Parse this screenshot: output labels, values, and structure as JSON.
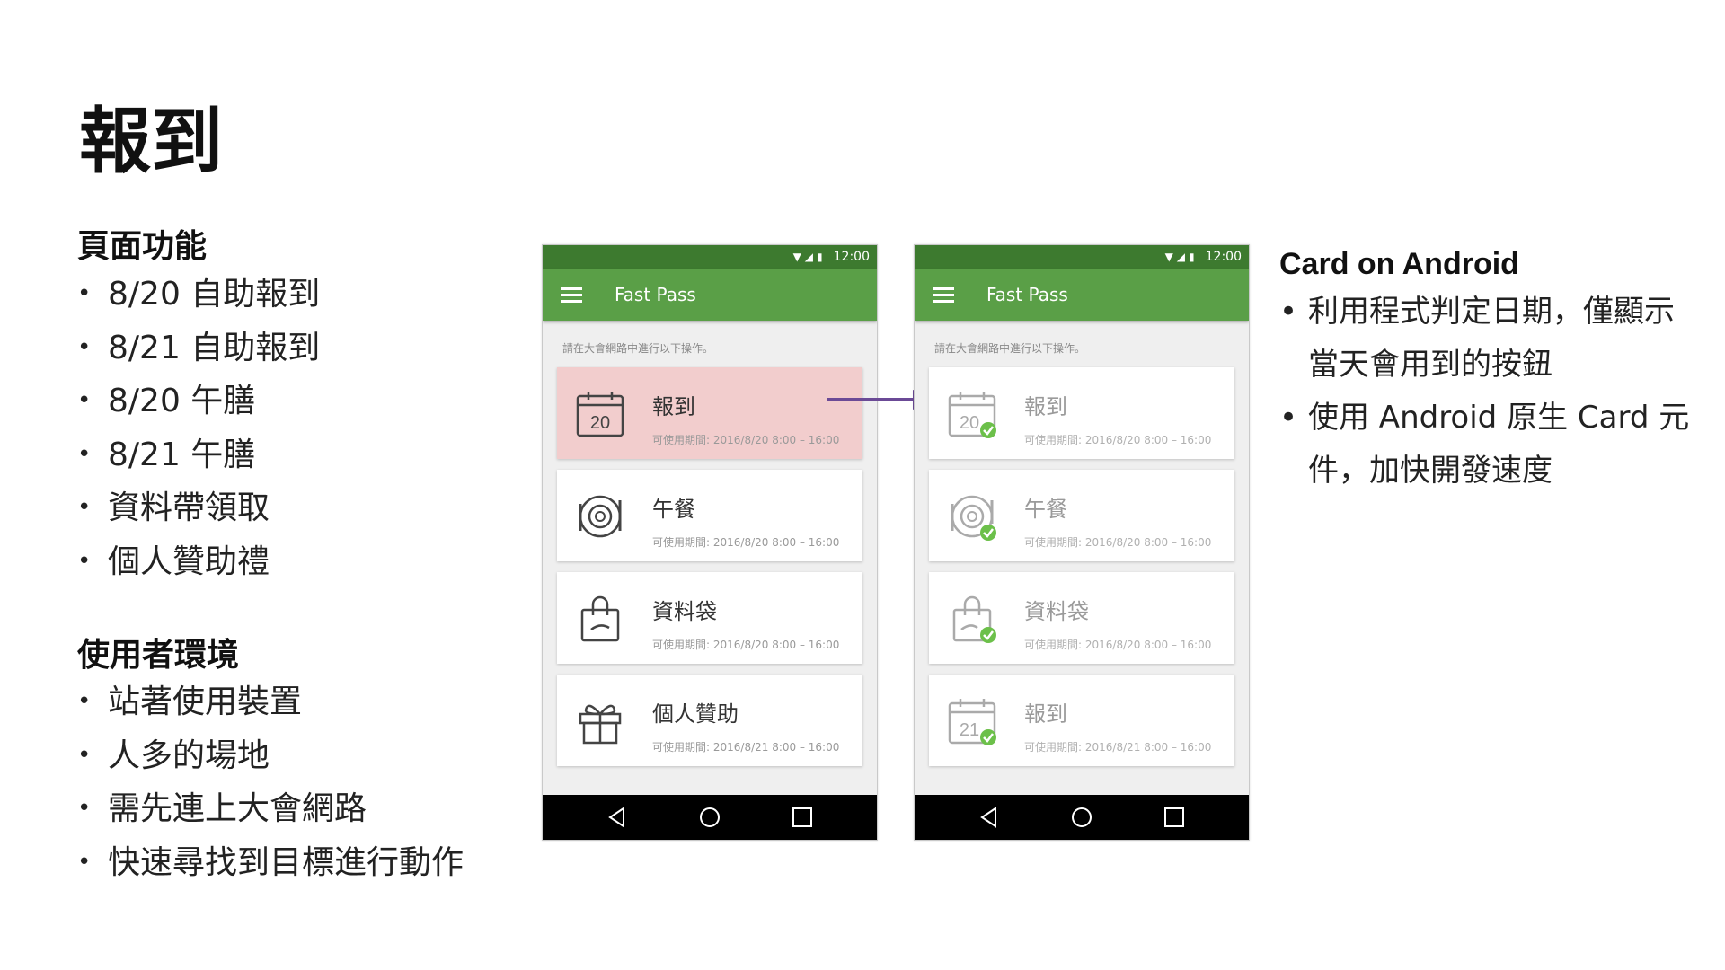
{
  "slide": {
    "title": "報到",
    "features": {
      "heading": "頁面功能",
      "items": [
        "8/20 自助報到",
        "8/21 自助報到",
        "8/20 午膳",
        "8/21 午膳",
        "資料帶領取",
        "個人贊助禮"
      ]
    },
    "environment": {
      "heading": "使用者環境",
      "items": [
        "站著使用裝置",
        "人多的場地",
        "需先連上大會網路",
        "快速尋找到目標進行動作"
      ]
    },
    "notes": {
      "heading": "Card on Android",
      "items": [
        "利用程式判定日期，僅顯示當天會用到的按鈕",
        "使用 Android 原生 Card 元件，加快開發速度"
      ]
    }
  },
  "bullet_char": "•",
  "phone_before": {
    "status_time": "12:00",
    "app_title": "Fast Pass",
    "hint": "請在大會網路中進行以下操作。",
    "cards": [
      {
        "title": "報到",
        "icon": "calendar-icon",
        "day": "20",
        "period": "可使用期間: 2016/8/20 8:00 – 16:00",
        "highlighted": true
      },
      {
        "title": "午餐",
        "icon": "plate-icon",
        "period": "可使用期間: 2016/8/20 8:00 – 16:00"
      },
      {
        "title": "資料袋",
        "icon": "bag-icon",
        "period": "可使用期間: 2016/8/20 8:00 – 16:00"
      },
      {
        "title": "個人贊助",
        "icon": "gift-icon",
        "period": "可使用期間: 2016/8/21 8:00 – 16:00"
      }
    ]
  },
  "phone_after": {
    "status_time": "12:00",
    "app_title": "Fast Pass",
    "hint": "請在大會網路中進行以下操作。",
    "cards": [
      {
        "title": "報到",
        "icon": "calendar-check-icon",
        "day": "20",
        "period": "可使用期間: 2016/8/20 8:00 – 16:00",
        "done": true
      },
      {
        "title": "午餐",
        "icon": "plate-check-icon",
        "period": "可使用期間: 2016/8/20 8:00 – 16:00",
        "done": true
      },
      {
        "title": "資料袋",
        "icon": "bag-check-icon",
        "period": "可使用期間: 2016/8/20 8:00 – 16:00",
        "done": true
      },
      {
        "title": "報到",
        "icon": "calendar-check-icon",
        "day": "21",
        "period": "可使用期間: 2016/8/21 8:00 – 16:00",
        "done": true
      }
    ]
  },
  "colors": {
    "appbar": "#5a9f47",
    "statusbar": "#3d7a2f",
    "highlight": "#f2cdcd",
    "check": "#6cc04a",
    "arrow": "#6b4a96"
  }
}
